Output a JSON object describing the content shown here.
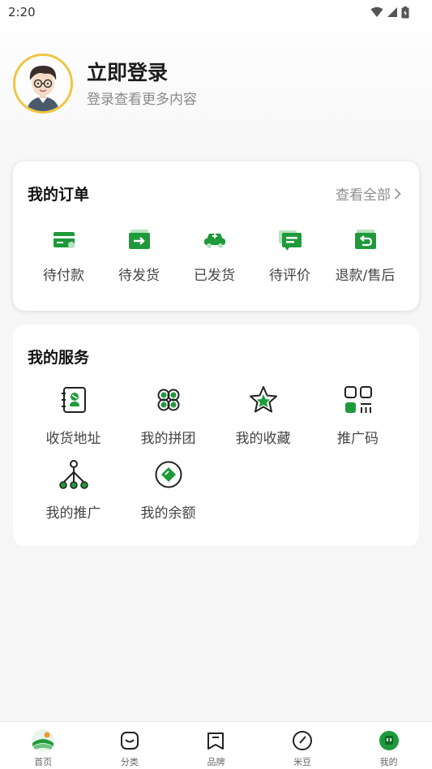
{
  "status_bar": {
    "time": "2:20"
  },
  "profile": {
    "title": "立即登录",
    "subtitle": "登录查看更多内容"
  },
  "orders": {
    "title": "我的订单",
    "view_all": "查看全部",
    "items": [
      {
        "label": "待付款",
        "icon": "wallet-card-icon"
      },
      {
        "label": "待发货",
        "icon": "ship-box-icon"
      },
      {
        "label": "已发货",
        "icon": "delivery-car-icon"
      },
      {
        "label": "待评价",
        "icon": "review-icon"
      },
      {
        "label": "退款/售后",
        "icon": "refund-icon"
      }
    ]
  },
  "services": {
    "title": "我的服务",
    "items": [
      {
        "label": "收货地址",
        "icon": "address-book-icon"
      },
      {
        "label": "我的拼团",
        "icon": "clover-icon"
      },
      {
        "label": "我的收藏",
        "icon": "star-icon"
      },
      {
        "label": "推广码",
        "icon": "qr-code-icon"
      },
      {
        "label": "我的推广",
        "icon": "network-tree-icon"
      },
      {
        "label": "我的余额",
        "icon": "balance-icon"
      }
    ]
  },
  "tab_bar": {
    "tabs": [
      {
        "label": "首页",
        "icon": "home-icon"
      },
      {
        "label": "分类",
        "icon": "category-icon"
      },
      {
        "label": "品牌",
        "icon": "brand-icon"
      },
      {
        "label": "米豆",
        "icon": "bean-icon"
      },
      {
        "label": "我的",
        "icon": "profile-icon"
      }
    ]
  },
  "colors": {
    "accent": "#1f9a3b",
    "avatar_ring": "#f0c541",
    "text_muted": "#8a8a8a"
  }
}
